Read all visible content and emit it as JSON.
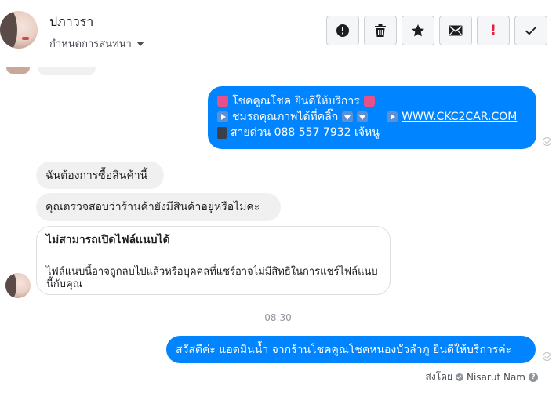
{
  "header": {
    "contact_name": "ปภาวรา",
    "subtitle": "กำหนดการสนทนา"
  },
  "actions": [
    {
      "name": "report-icon"
    },
    {
      "name": "trash-icon"
    },
    {
      "name": "star-icon"
    },
    {
      "name": "envelope-icon"
    },
    {
      "name": "exclamation-icon",
      "label": "!"
    },
    {
      "name": "checkmark-icon"
    }
  ],
  "messages": {
    "out1": {
      "line1": "โชคคูณโชค ยินดีให้บริการ",
      "line2_prefix": "ชมรถคุณภาพได้ที่คลิ๊ก",
      "line2_link": "WWW.CKC2CAR.COM",
      "line3": "สายด่วน 088 557 7932 เจ้หนู"
    },
    "in1": "ฉันต้องการซื้อสินค้านี้",
    "in2": "คุณตรวจสอบว่าร้านค้ายังมีสินค้าอยู่หรือไม่คะ",
    "attachment": {
      "title": "ไม่สามารถเปิดไฟล์แนบได้",
      "description": "ไฟล์แนบนี้อาจถูกลบไปแล้วหรือบุคคลที่แชร์อาจไม่มีสิทธิในการแชร์ไฟล์แนบนี้กับคุณ"
    },
    "timestamp": "08:30",
    "out2": "สวัสดีค่ะ แอดมินน้ำ จากร้านโชคคูณโชคหนองบัวลำภู ยินดีให้บริการค่ะ"
  },
  "sent_by": {
    "prefix": "ส่งโดย",
    "name": "Nisarut Nam",
    "help": "?"
  },
  "colors": {
    "outgoing_bubble": "#0084ff",
    "incoming_bubble": "#f1f0f0",
    "alert": "#e41e3f"
  }
}
